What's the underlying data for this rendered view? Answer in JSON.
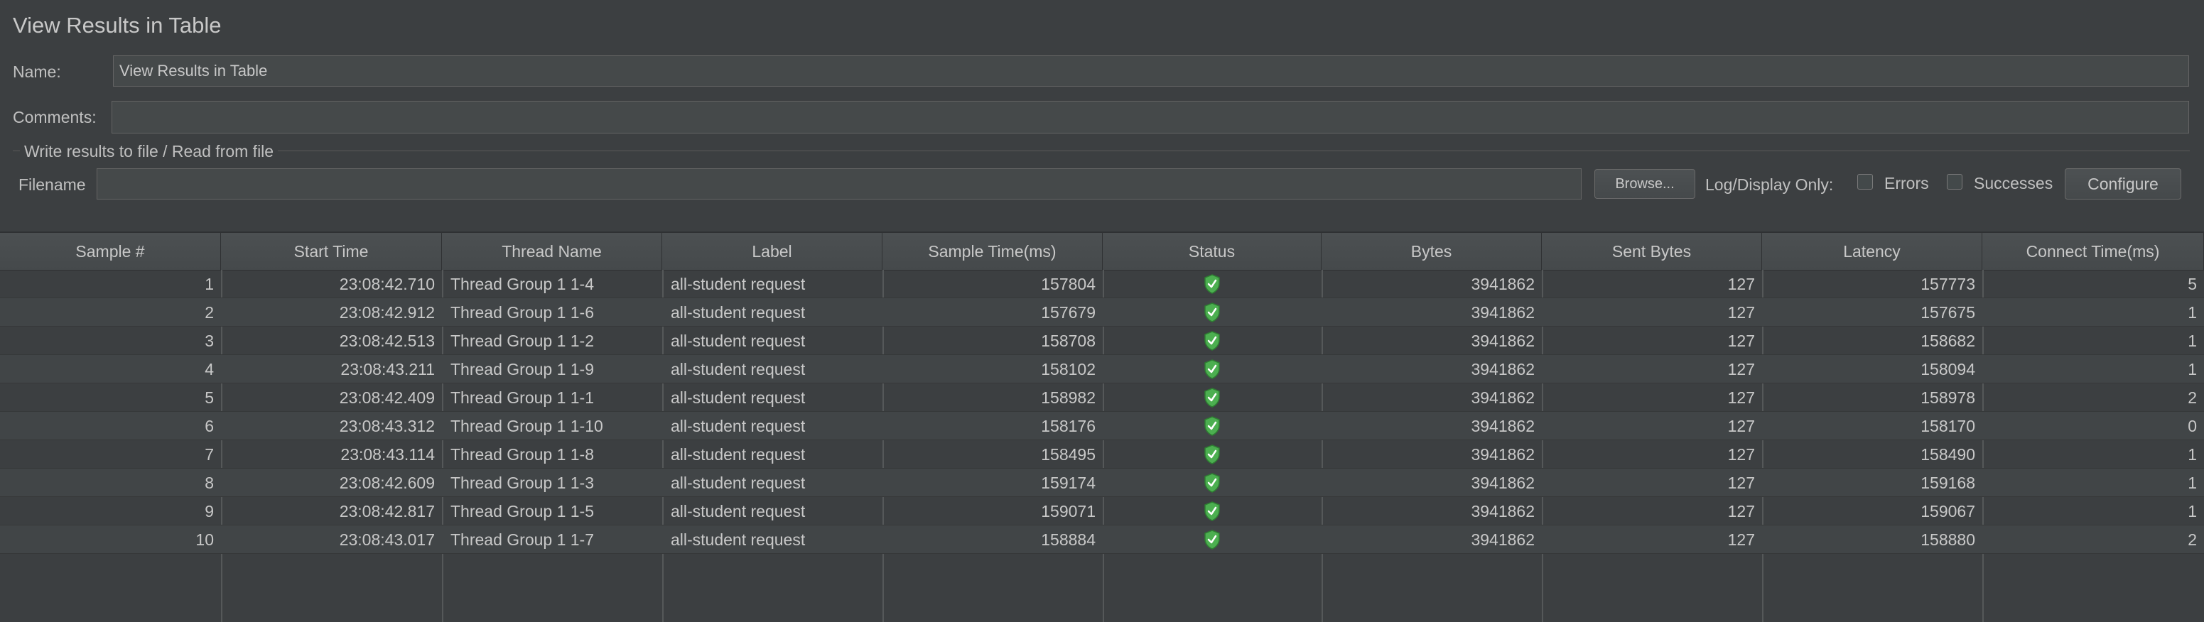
{
  "panel": {
    "title": "View Results in Table",
    "name_label": "Name:",
    "name_value": "View Results in Table",
    "comments_label": "Comments:",
    "comments_value": "",
    "file_group_title": "Write results to file / Read from file",
    "filename_label": "Filename",
    "filename_value": "",
    "browse_label": "Browse...",
    "log_display_label": "Log/Display Only:",
    "errors_label": "Errors",
    "errors_checked": false,
    "successes_label": "Successes",
    "successes_checked": false,
    "configure_label": "Configure"
  },
  "table": {
    "columns": [
      "Sample #",
      "Start Time",
      "Thread Name",
      "Label",
      "Sample Time(ms)",
      "Status",
      "Bytes",
      "Sent Bytes",
      "Latency",
      "Connect Time(ms)"
    ],
    "rows": [
      {
        "sample": "1",
        "start": "23:08:42.710",
        "thread": "Thread Group 1 1-4",
        "label": "all-student request",
        "time": "157804",
        "status": "success-shield-icon",
        "bytes": "3941862",
        "sent": "127",
        "latency": "157773",
        "connect": "5"
      },
      {
        "sample": "2",
        "start": "23:08:42.912",
        "thread": "Thread Group 1 1-6",
        "label": "all-student request",
        "time": "157679",
        "status": "success-shield-icon",
        "bytes": "3941862",
        "sent": "127",
        "latency": "157675",
        "connect": "1"
      },
      {
        "sample": "3",
        "start": "23:08:42.513",
        "thread": "Thread Group 1 1-2",
        "label": "all-student request",
        "time": "158708",
        "status": "success-shield-icon",
        "bytes": "3941862",
        "sent": "127",
        "latency": "158682",
        "connect": "1"
      },
      {
        "sample": "4",
        "start": "23:08:43.211",
        "thread": "Thread Group 1 1-9",
        "label": "all-student request",
        "time": "158102",
        "status": "success-shield-icon",
        "bytes": "3941862",
        "sent": "127",
        "latency": "158094",
        "connect": "1"
      },
      {
        "sample": "5",
        "start": "23:08:42.409",
        "thread": "Thread Group 1 1-1",
        "label": "all-student request",
        "time": "158982",
        "status": "success-shield-icon",
        "bytes": "3941862",
        "sent": "127",
        "latency": "158978",
        "connect": "2"
      },
      {
        "sample": "6",
        "start": "23:08:43.312",
        "thread": "Thread Group 1 1-10",
        "label": "all-student request",
        "time": "158176",
        "status": "success-shield-icon",
        "bytes": "3941862",
        "sent": "127",
        "latency": "158170",
        "connect": "0"
      },
      {
        "sample": "7",
        "start": "23:08:43.114",
        "thread": "Thread Group 1 1-8",
        "label": "all-student request",
        "time": "158495",
        "status": "success-shield-icon",
        "bytes": "3941862",
        "sent": "127",
        "latency": "158490",
        "connect": "1"
      },
      {
        "sample": "8",
        "start": "23:08:42.609",
        "thread": "Thread Group 1 1-3",
        "label": "all-student request",
        "time": "159174",
        "status": "success-shield-icon",
        "bytes": "3941862",
        "sent": "127",
        "latency": "159168",
        "connect": "1"
      },
      {
        "sample": "9",
        "start": "23:08:42.817",
        "thread": "Thread Group 1 1-5",
        "label": "all-student request",
        "time": "159071",
        "status": "success-shield-icon",
        "bytes": "3941862",
        "sent": "127",
        "latency": "159067",
        "connect": "1"
      },
      {
        "sample": "10",
        "start": "23:08:43.017",
        "thread": "Thread Group 1 1-7",
        "label": "all-student request",
        "time": "158884",
        "status": "success-shield-icon",
        "bytes": "3941862",
        "sent": "127",
        "latency": "158880",
        "connect": "2"
      }
    ]
  },
  "colors": {
    "background": "#3c3f41",
    "status_success": "#4caf50"
  }
}
